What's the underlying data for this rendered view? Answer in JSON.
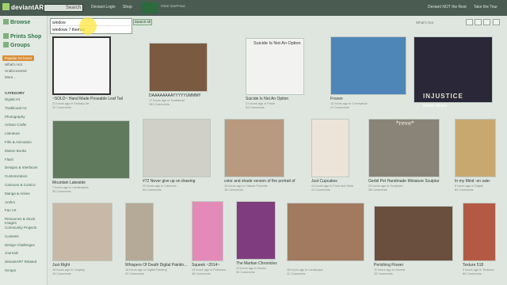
{
  "topbar": {
    "logo": "deviantART",
    "search_button": "Search",
    "nav": [
      "Deviant Login",
      "Shop",
      "Shop"
    ],
    "badge_text": "FREE SHIPPING",
    "right": [
      "Deviant NOT the Rest",
      "Take the Tour"
    ]
  },
  "sidebar": {
    "browse": "Browse",
    "prints_shop": "Prints Shop",
    "groups": "Groups",
    "popular_label": "Popular 24 hours",
    "links": [
      "What's Hot",
      "Undiscovered",
      "More..."
    ],
    "category_heading": "CATEGORY",
    "categories": [
      "Digital Art",
      "Traditional Art",
      "Photography",
      "Artisan Crafts",
      "Literature",
      "Film & Animation",
      "Motion Books",
      "Flash",
      "Designs & Interfaces",
      "Customization",
      "Cartoons & Comics",
      "Manga & Anime",
      "Anthro",
      "Fan Art",
      "Resources & Stock Images",
      "Community Projects",
      "Contests",
      "Design Challenges",
      "Journals",
      "deviantART Related",
      "Scraps"
    ]
  },
  "search": {
    "value": "window",
    "option": "windows 7 themes",
    "search_all": "Search All"
  },
  "results_header": {
    "whats_hot": "What's Hot"
  },
  "thumbs": [
    {
      "title": "~SOLD~ Hand Made Poseable Leaf Tail Guard...",
      "meta": "21 hours ago in Fantasy Art",
      "stats": "32 Comments"
    },
    {
      "title": "DAAAAAAAAYYYYYUMMM!!",
      "meta": "17 hours ago in Traditional",
      "stats": "281 Comments"
    },
    {
      "title": "Suicide Is Not An Option",
      "meta": "21 hours ago in Prose",
      "stats": "64 Comments"
    },
    {
      "title": "Frozen",
      "meta": "12 hours ago in Conceptual",
      "stats": "47 Comments"
    },
    {
      "title": "",
      "meta": "",
      "stats": ""
    },
    {
      "title": "Mountain Lakeside",
      "meta": "7 hours ago in Landscapes",
      "stats": "35 Comments"
    },
    {
      "title": "#72 Never give up on drawing",
      "meta": "20 hours ago in Cartoons",
      "stats": "54 Comments"
    },
    {
      "title": "color and shade version of the portrait of N",
      "meta": "16 hours ago in Classic Portraits",
      "stats": "18 Comments"
    },
    {
      "title": "Just Cupcakes",
      "meta": "14 hours ago in Food and Drink",
      "stats": "41 Comments"
    },
    {
      "title": "Gerbil Pet Handmade Miniature Sculpture",
      "meta": "23 hours ago in Sculpture",
      "stats": "38 Comments"
    },
    {
      "title": "In my Mind -on sale-",
      "meta": "6 hours ago in Digital",
      "stats": "64 Comments"
    },
    {
      "title": "Just Right",
      "meta": "18 hours ago in Cosplay",
      "stats": "15 Comments"
    },
    {
      "title": "Whispers Of Death Digital Paintin...",
      "meta": "16 hours ago in Digital Painting",
      "stats": "22 Comments"
    },
    {
      "title": "Squeek ~2014~",
      "meta": "19 hours ago in Pokemon",
      "stats": "48 Comments"
    },
    {
      "title": "The Martian Chronicles",
      "meta": "13 hours ago in Books",
      "stats": "26 Comments"
    },
    {
      "title": "",
      "meta": "18 hours ago in Landscape",
      "stats": "11 Comments"
    },
    {
      "title": "Perishing Flower",
      "meta": "11 hours ago in Surreal",
      "stats": "33 Comments"
    },
    {
      "title": "Texture 518",
      "meta": "9 hours ago in Textures",
      "stats": "60 Comments"
    }
  ],
  "overlay_text": {
    "suicide_title": "Suicide Is Not An Option",
    "reve": "*reve*",
    "injustice": "INJUSTICE",
    "motion_books": "Motion Books"
  },
  "colors": {
    "topbar": "#4a5b52",
    "accent_green": "#31784a",
    "selected_orange": "#d98f3a",
    "background": "#dfe6df"
  }
}
